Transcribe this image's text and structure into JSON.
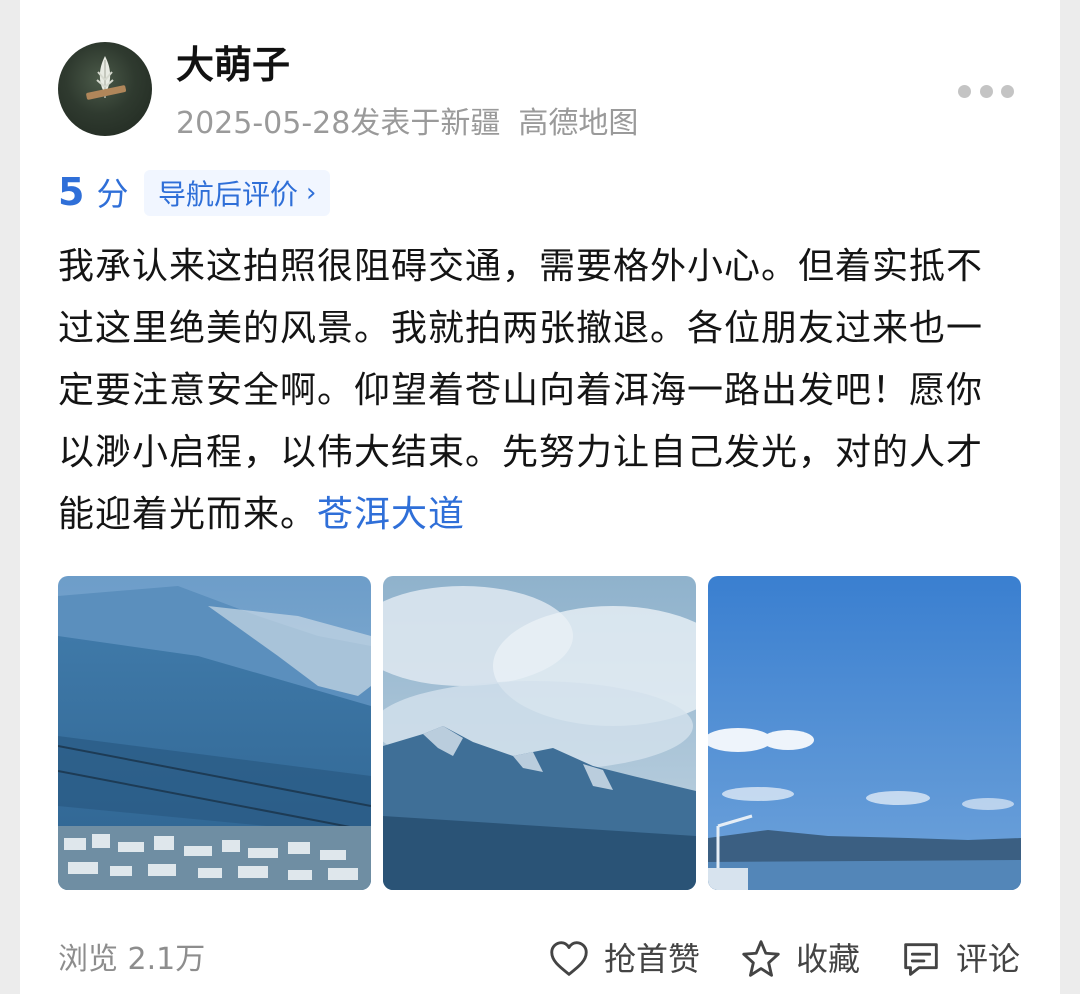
{
  "post": {
    "author": "大萌子",
    "date_location": "2025-05-28发表于新疆",
    "source": "高德地图",
    "score_value": "5",
    "score_unit": "分",
    "nav_review_label": "导航后评价",
    "content": "我承认来这拍照很阻碍交通，需要格外小心。但着实抵不过这里绝美的风景。我就拍两张撤退。各位朋友过来也一定要注意安全啊。仰望着苍山向着洱海一路出发吧！愿你以渺小启程，以伟大结束。先努力让自己发光，对的人才能迎着光而来。",
    "topic_tag": "苍洱大道"
  },
  "photos": [
    {
      "name": "mountain-slope-photo"
    },
    {
      "name": "clouds-peak-photo"
    },
    {
      "name": "blue-sky-lake-photo"
    }
  ],
  "footer": {
    "views": "浏览 2.1万",
    "like_label": "抢首赞",
    "favorite_label": "收藏",
    "comment_label": "评论"
  },
  "icons": {
    "more": "more-dots-icon",
    "like": "heart-icon",
    "favorite": "star-icon",
    "comment": "comment-icon",
    "chevron": "chevron-right-icon"
  },
  "colors": {
    "accent": "#2f6fd8",
    "muted": "#9a9a9a"
  }
}
